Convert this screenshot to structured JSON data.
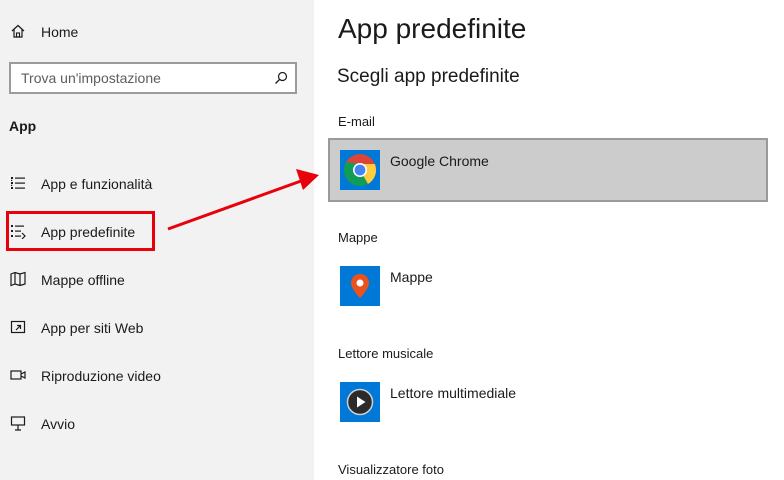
{
  "sidebar": {
    "home_label": "Home",
    "search_placeholder": "Trova un'impostazione",
    "section_title": "App",
    "items": [
      {
        "label": "App e funzionalità",
        "icon": "list-icon"
      },
      {
        "label": "App predefinite",
        "icon": "default-apps-icon",
        "highlighted": true
      },
      {
        "label": "Mappe offline",
        "icon": "map-icon"
      },
      {
        "label": "App per siti Web",
        "icon": "open-in-window-icon"
      },
      {
        "label": "Riproduzione video",
        "icon": "video-icon"
      },
      {
        "label": "Avvio",
        "icon": "startup-icon"
      }
    ]
  },
  "main": {
    "title": "App predefinite",
    "subtitle": "Scegli app predefinite",
    "categories": [
      {
        "label": "E-mail",
        "app": "Google Chrome",
        "icon": "chrome-icon",
        "selected": true
      },
      {
        "label": "Mappe",
        "app": "Mappe",
        "icon": "maps-pin-icon"
      },
      {
        "label": "Lettore musicale",
        "app": "Lettore multimediale",
        "icon": "media-player-icon"
      },
      {
        "label": "Visualizzatore foto"
      }
    ]
  },
  "colors": {
    "sidebar_bg": "#f2f2f2",
    "accent_tile": "#0078d7",
    "selected_row": "#cccccc",
    "annotation_red": "#e8000b"
  }
}
